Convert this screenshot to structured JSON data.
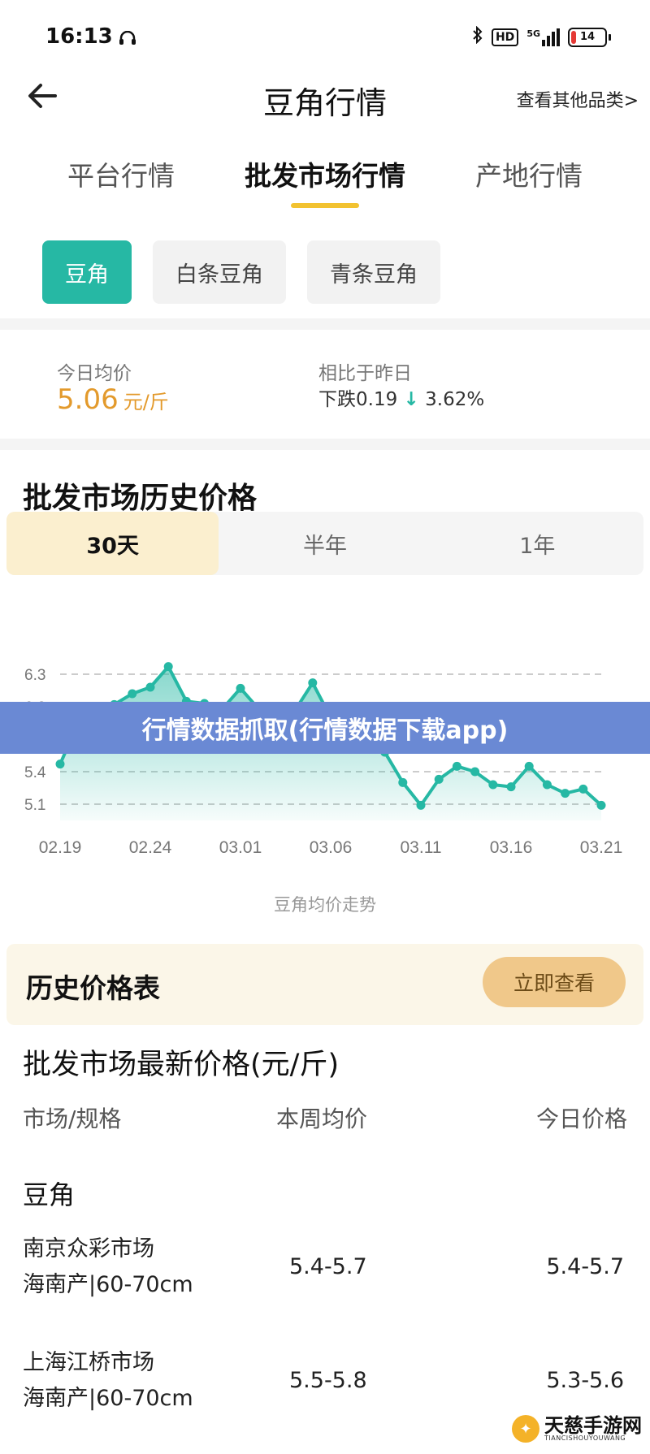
{
  "status_bar": {
    "time": "16:13",
    "network": "5G",
    "hd": "HD",
    "battery": "14",
    "battery_level": 0.14
  },
  "header": {
    "title": "豆角行情",
    "other_link": "查看其他品类>"
  },
  "tabs": [
    {
      "label": "平台行情",
      "active": false
    },
    {
      "label": "批发市场行情",
      "active": true
    },
    {
      "label": "产地行情",
      "active": false
    }
  ],
  "chips": [
    {
      "label": "豆角",
      "active": true
    },
    {
      "label": "白条豆角",
      "active": false
    },
    {
      "label": "青条豆角",
      "active": false
    }
  ],
  "summary": {
    "today_label": "今日均价",
    "today_price": "5.06",
    "unit": "元/斤",
    "compare_label": "相比于昨日",
    "change_text": "下跌0.19",
    "change_arrow": "↓",
    "change_pct": "3.62%"
  },
  "history": {
    "title": "批发市场历史价格",
    "ranges": [
      {
        "label": "30天",
        "active": true
      },
      {
        "label": "半年",
        "active": false
      },
      {
        "label": "1年",
        "active": false
      }
    ],
    "caption": "豆角均价走势"
  },
  "chart_data": {
    "type": "area",
    "title": "",
    "xlabel": "豆角均价走势",
    "ylabel": "",
    "x_ticks": [
      "02.19",
      "02.24",
      "03.01",
      "03.06",
      "03.11",
      "03.16",
      "03.21"
    ],
    "y_ticks": [
      5.1,
      5.4,
      5.7,
      6.0,
      6.3
    ],
    "ylim": [
      4.95,
      6.45
    ],
    "grid": true,
    "values": [
      5.47,
      5.85,
      5.75,
      6.02,
      6.12,
      6.18,
      6.37,
      6.05,
      6.03,
      5.98,
      6.17,
      5.98,
      5.96,
      5.96,
      6.22,
      5.9,
      5.85,
      5.72,
      5.58,
      5.3,
      5.09,
      5.33,
      5.45,
      5.4,
      5.28,
      5.26,
      5.45,
      5.28,
      5.2,
      5.24,
      5.09
    ],
    "line_color": "#26b8a4",
    "fill_color": "#26b8a4"
  },
  "banner": {
    "text": "行情数据抓取(行情数据下载app)"
  },
  "price_table_card": {
    "title": "历史价格表",
    "button": "立即查看"
  },
  "latest": {
    "title": "批发市场最新价格(元/斤)",
    "columns": [
      "市场/规格",
      "本周均价",
      "今日价格"
    ],
    "group": "豆角",
    "rows": [
      {
        "market": "南京众彩市场",
        "spec": "海南产|60-70cm",
        "week_avg": "5.4-5.7",
        "today": "5.4-5.7"
      },
      {
        "market": "上海江桥市场",
        "spec": "海南产|60-70cm",
        "week_avg": "5.5-5.8",
        "today": "5.3-5.6"
      }
    ]
  },
  "watermark": {
    "main": "天慈手游网",
    "sub": "TIANCISHOUYOUWANG"
  }
}
